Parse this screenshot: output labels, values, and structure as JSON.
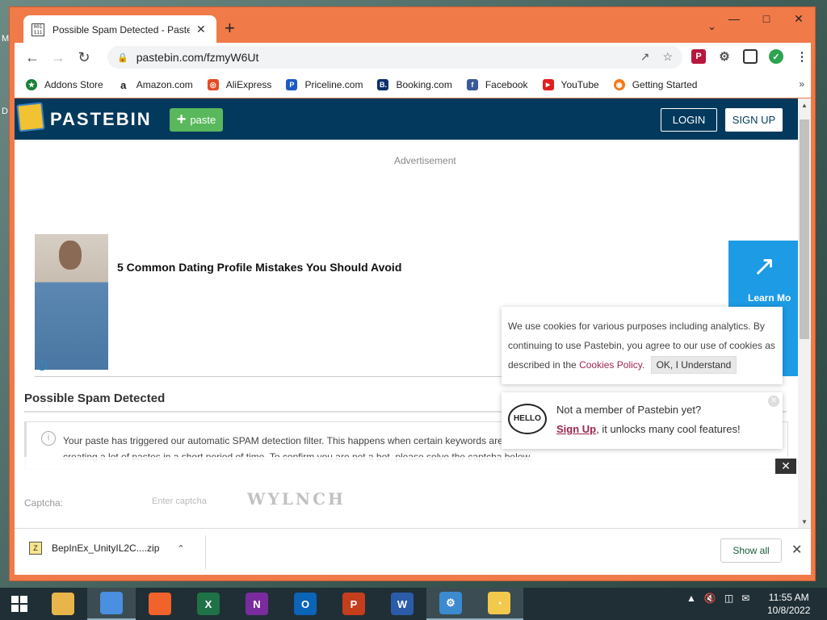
{
  "desktop": {
    "label_m": "M",
    "label_d": "D"
  },
  "browser": {
    "tab_title": "Possible Spam Detected - Pastebin",
    "tab_favicon": "001 111",
    "new_tab_symbol": "+",
    "url": "pastebin.com/fzmyW6Ut",
    "bookmarks": [
      {
        "label": "Addons Store",
        "color": "#1a7f37",
        "icon": "★"
      },
      {
        "label": "Amazon.com",
        "color": "#222222",
        "icon": "a"
      },
      {
        "label": "AliExpress",
        "color": "#e54a24",
        "icon": "◎"
      },
      {
        "label": "Priceline.com",
        "color": "#1e5ac6",
        "icon": "P"
      },
      {
        "label": "Booking.com",
        "color": "#0b2f6b",
        "icon": "B."
      },
      {
        "label": "Facebook",
        "color": "#3b5998",
        "icon": "f"
      },
      {
        "label": "YouTube",
        "color": "#e01e1e",
        "icon": "▶"
      },
      {
        "label": "Getting Started",
        "color": "#f07a1a",
        "icon": "◉"
      }
    ]
  },
  "page": {
    "logo_text": "PASTEBIN",
    "paste_label": "paste",
    "login_label": "LOGIN",
    "signup_label": "SIGN UP",
    "ad_label": "Advertisement",
    "ad_title": "5 Common Dating Profile Mistakes You Should Avoid",
    "ad_cta": "Learn Mo",
    "spam_title": "Possible Spam Detected",
    "notice_text": "Your paste has triggered our automatic SPAM detection filter. This happens when certain keywords are used, or when creating a lot of pastes in a short period of time. To confirm you are not a bot, please solve the captcha below.",
    "captcha_label": "Captcha:",
    "captcha_placeholder": "Enter captcha",
    "captcha_image_text": "WYLNCH",
    "cookie_text_1": "We use cookies for various purposes including analytics. By continuing to use Pastebin, you agree to our use of cookies as described in the",
    "cookie_link": "Cookies Policy",
    "cookie_ok": "OK, I Understand",
    "member_question": "Not a member of Pastebin yet?",
    "member_link": "Sign Up",
    "member_rest": ", it unlocks many cool features!",
    "hello_text": "HELLO"
  },
  "download_bar": {
    "file_name": "BepInEx_UnityIL2C....zip",
    "show_all": "Show all"
  },
  "taskbar": {
    "time": "11:55 AM",
    "date": "10/8/2022",
    "apps": [
      {
        "name": "file-explorer-icon",
        "color": "#e8b54a",
        "label": "",
        "active": false
      },
      {
        "name": "chrome-icon",
        "color": "#4a8fe0",
        "label": "",
        "active": true
      },
      {
        "name": "firefox-icon",
        "color": "#f0632a",
        "label": "",
        "active": false
      },
      {
        "name": "excel-icon",
        "color": "#1f7246",
        "label": "X",
        "active": false
      },
      {
        "name": "onenote-icon",
        "color": "#7a2c9e",
        "label": "N",
        "active": false
      },
      {
        "name": "outlook-icon",
        "color": "#0a64b8",
        "label": "O",
        "active": false
      },
      {
        "name": "powerpoint-icon",
        "color": "#c43e1c",
        "label": "P",
        "active": false
      },
      {
        "name": "word-icon",
        "color": "#2a5caa",
        "label": "W",
        "active": false
      },
      {
        "name": "vpn-icon",
        "color": "#3c8ad0",
        "label": "⚙",
        "active": true
      },
      {
        "name": "security-icon",
        "color": "#f2c94c",
        "label": "◔",
        "active": true
      }
    ]
  }
}
